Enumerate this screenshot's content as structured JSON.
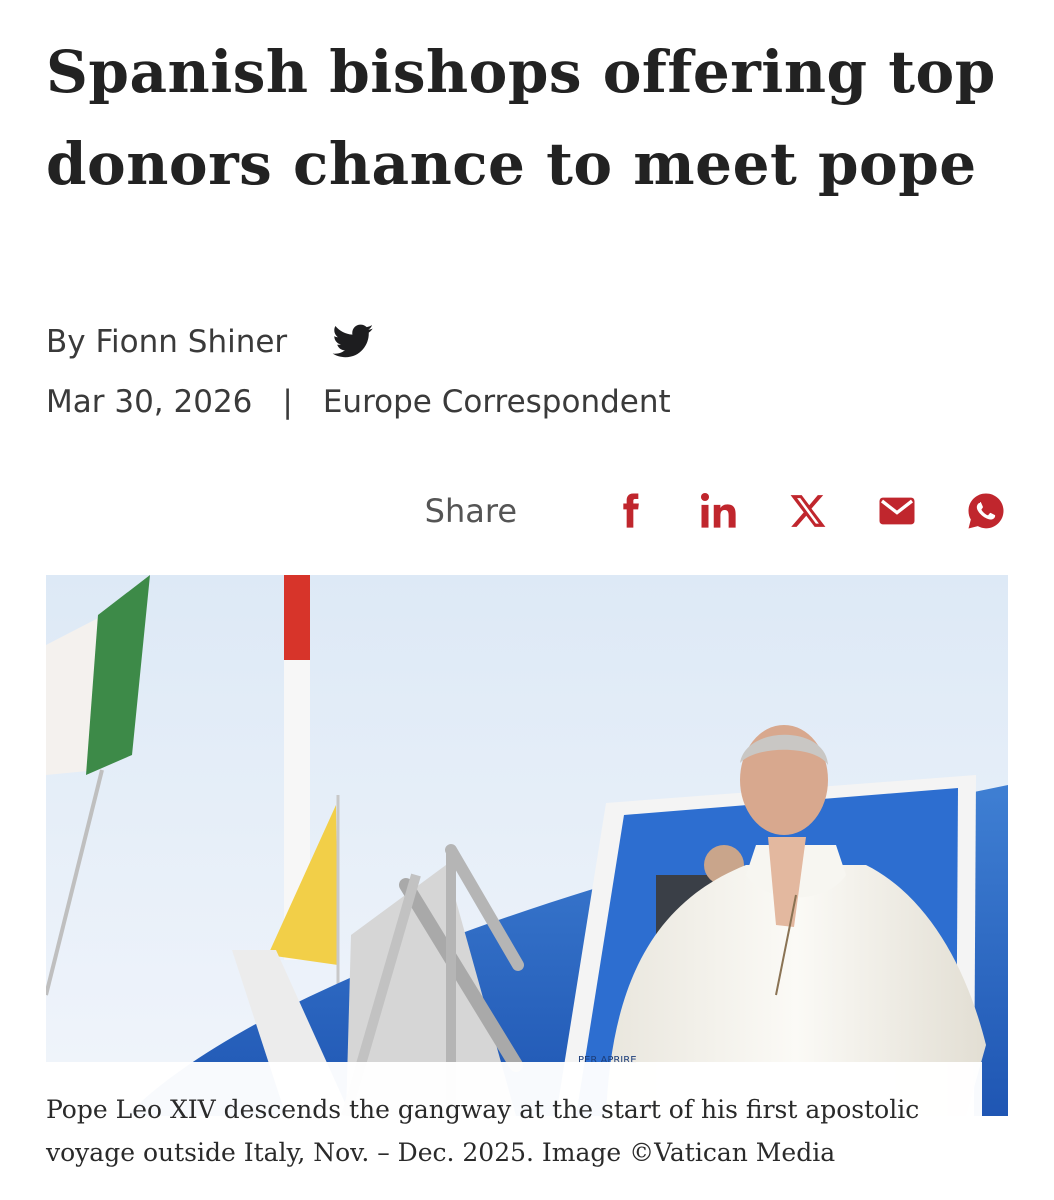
{
  "article": {
    "headline": "Spanish bishops offering top donors chance to meet pope",
    "byline": "By Fionn Shiner",
    "date": "Mar 30, 2026",
    "separator": "|",
    "role": "Europe Correspondent"
  },
  "share": {
    "label": "Share",
    "buttons": [
      "facebook-icon",
      "linkedin-icon",
      "x-icon",
      "email-icon",
      "whatsapp-icon"
    ],
    "accent_color": "#c0262d"
  },
  "image": {
    "caption": "Pope Leo XIV descends the gangway at the start of his first apostolic voyage outside Italy, Nov. – Dec. 2025. Image ©Vatican Media",
    "stair_text": "PER APRIRE"
  }
}
